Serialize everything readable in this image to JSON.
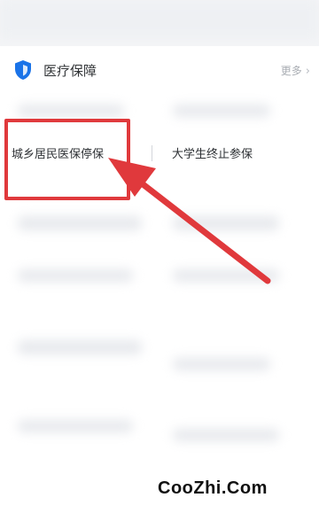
{
  "section": {
    "title": "医疗保障",
    "more_label": "更多",
    "icon": "shield-icon"
  },
  "options": {
    "left": "城乡居民医保停保",
    "right": "大学生终止参保"
  },
  "colors": {
    "highlight": "#e0393c",
    "shield": "#1a73e8"
  },
  "watermark": "CooZhi.Com"
}
